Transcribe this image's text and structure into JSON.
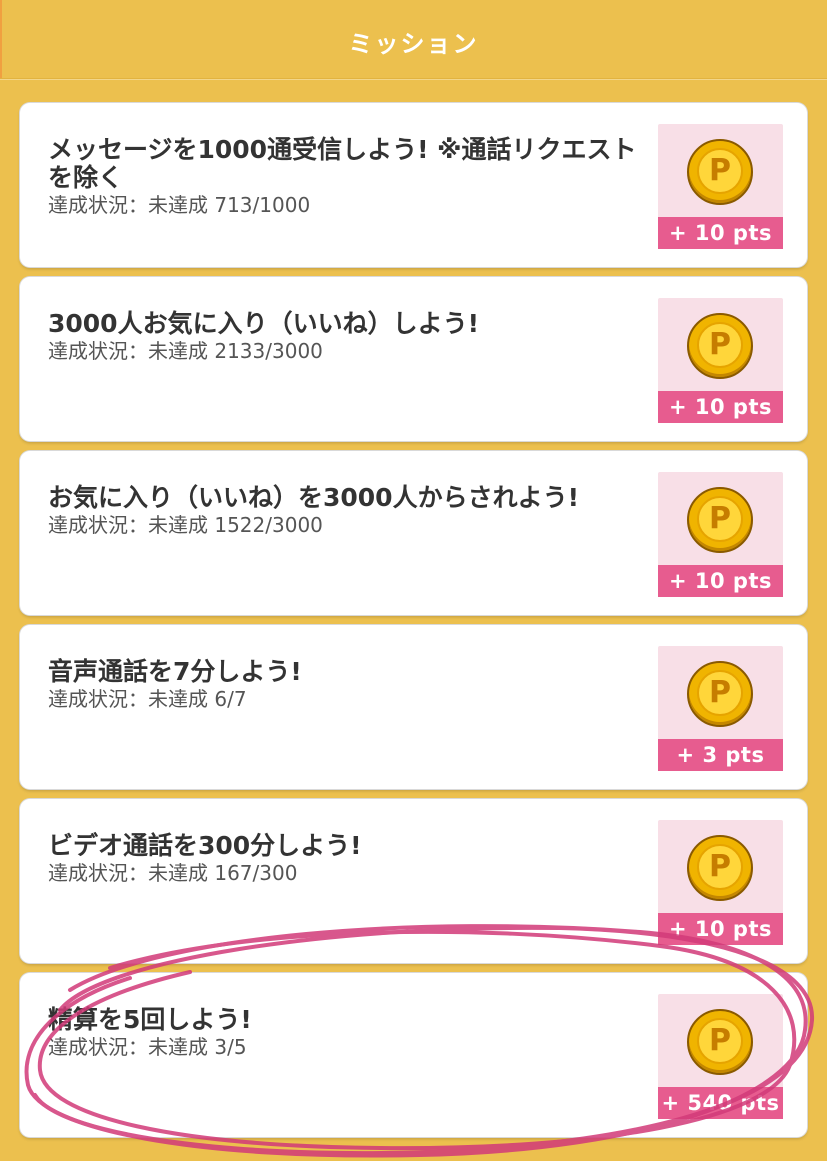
{
  "header": {
    "title": "ミッション"
  },
  "missions": [
    {
      "title": "メッセージを1000通受信しよう! ※通話リクエストを除く",
      "status": "達成状況：未達成 713/1000",
      "reward": "+ 10 pts",
      "icon": "coin-p-icon"
    },
    {
      "title": "3000人お気に入り（いいね）しよう!",
      "status": "達成状況：未達成 2133/3000",
      "reward": "+ 10 pts",
      "icon": "coin-p-icon"
    },
    {
      "title": "お気に入り（いいね）を3000人からされよう!",
      "status": "達成状況：未達成 1522/3000",
      "reward": "+ 10 pts",
      "icon": "coin-p-icon"
    },
    {
      "title": "音声通話を7分しよう!",
      "status": "達成状況：未達成 6/7",
      "reward": "+ 3 pts",
      "icon": "coin-p-icon"
    },
    {
      "title": "ビデオ通話を300分しよう!",
      "status": "達成状況：未達成 167/300",
      "reward": "+ 10 pts",
      "icon": "coin-p-icon"
    },
    {
      "title": "精算を5回しよう!",
      "status": "達成状況：未達成 3/5",
      "reward": "+ 540 pts",
      "icon": "coin-p-icon"
    }
  ],
  "coin_letter": "P",
  "colors": {
    "background": "#ecc04e",
    "reward_bg": "#f8dfe7",
    "reward_bar": "#e75c8f",
    "annotation": "#d23a79"
  }
}
